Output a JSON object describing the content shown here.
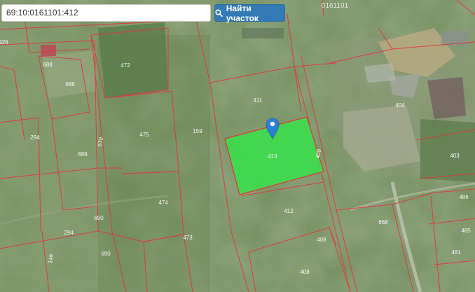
{
  "search": {
    "value": "69:10:0161101:412",
    "button_label": "Найти участок",
    "button_icon": "search-icon"
  },
  "map": {
    "sector_label": "0161101",
    "highlight_color": "#38e04a",
    "boundary_color": "#e8323c",
    "marker_color": "#2c7fd6",
    "parcels": [
      {
        "label": "926"
      },
      {
        "label": "688"
      },
      {
        "label": "688"
      },
      {
        "label": "472"
      },
      {
        "label": "411"
      },
      {
        "label": "404"
      },
      {
        "label": "294"
      },
      {
        "label": "689"
      },
      {
        "label": "475"
      },
      {
        "label": "159"
      },
      {
        "label": "413"
      },
      {
        "label": "409"
      },
      {
        "label": "403"
      },
      {
        "label": "474"
      },
      {
        "label": "412"
      },
      {
        "label": "690"
      },
      {
        "label": "294"
      },
      {
        "label": "473"
      },
      {
        "label": "690"
      },
      {
        "label": "408"
      },
      {
        "label": "668"
      },
      {
        "label": "486"
      },
      {
        "label": "485"
      },
      {
        "label": "481"
      },
      {
        "label": "408"
      },
      {
        "label": "670"
      },
      {
        "label": "149"
      }
    ]
  }
}
